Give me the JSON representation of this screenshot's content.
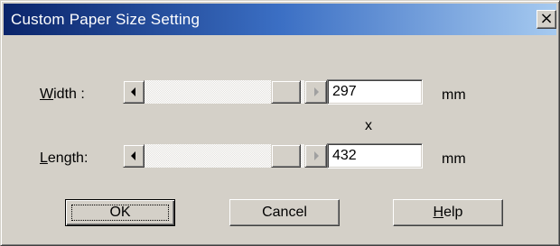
{
  "window": {
    "title": "Custom Paper Size Setting",
    "close_glyph": "×"
  },
  "width_row": {
    "label_mnemonic": "W",
    "label_rest": "idth :",
    "value": "297",
    "unit": "mm"
  },
  "separator": "x",
  "length_row": {
    "label_mnemonic": "L",
    "label_rest": "ength:",
    "value": "432",
    "unit": "mm"
  },
  "buttons": {
    "ok": "OK",
    "cancel": "Cancel",
    "help_mnemonic": "H",
    "help_rest": "elp"
  },
  "icons": {
    "scroll_left": "left-arrow-icon",
    "scroll_right": "right-arrow-icon",
    "close": "close-icon"
  },
  "colors": {
    "title_gradient_start": "#0a246a",
    "title_gradient_end": "#a6caf0",
    "face": "#d4d0c8"
  }
}
